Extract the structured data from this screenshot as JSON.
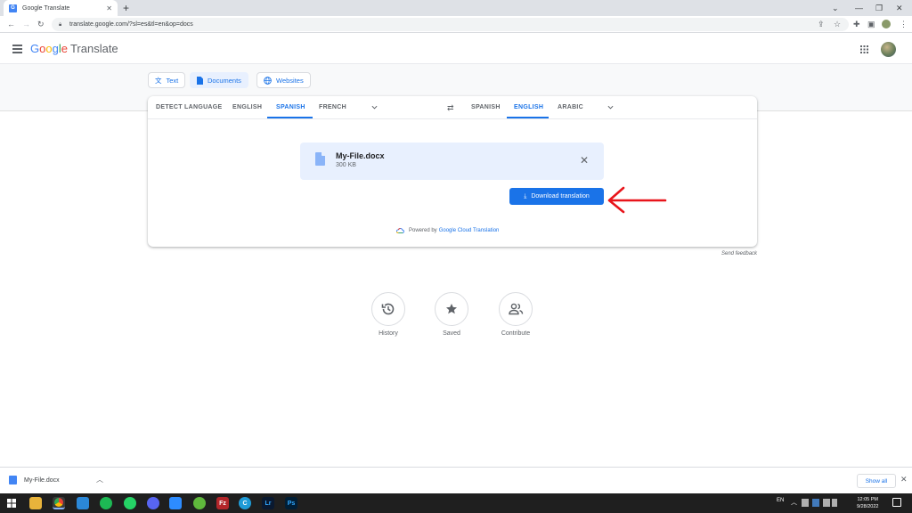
{
  "browser": {
    "tab_title": "Google Translate",
    "tab_close": "✕",
    "new_tab": "+",
    "url": "translate.google.com/?sl=es&tl=en&op=docs"
  },
  "app": {
    "logo_g": [
      "G",
      "o",
      "o",
      "g",
      "l",
      "e"
    ],
    "logo_product": "Translate"
  },
  "modes": {
    "text": "Text",
    "documents": "Documents",
    "websites": "Websites"
  },
  "source_langs": {
    "detect": "DETECT LANGUAGE",
    "english": "ENGLISH",
    "spanish": "SPANISH",
    "french": "FRENCH"
  },
  "target_langs": {
    "spanish": "SPANISH",
    "english": "ENGLISH",
    "arabic": "ARABIC"
  },
  "file": {
    "name": "My-File.docx",
    "size": "300 KB"
  },
  "download_button": "Download translation",
  "powered": {
    "prefix": "Powered by",
    "link": "Google Cloud Translation"
  },
  "feedback": "Send feedback",
  "shortcuts": {
    "history": "History",
    "saved": "Saved",
    "contribute": "Contribute"
  },
  "shelf": {
    "file": "My-File.docx",
    "show_all": "Show all"
  },
  "system": {
    "lang": "EN",
    "time": "12:05 PM",
    "date": "9/28/2022"
  },
  "colors": {
    "accent": "#1a73e8",
    "annotation_arrow": "#e8151b"
  }
}
